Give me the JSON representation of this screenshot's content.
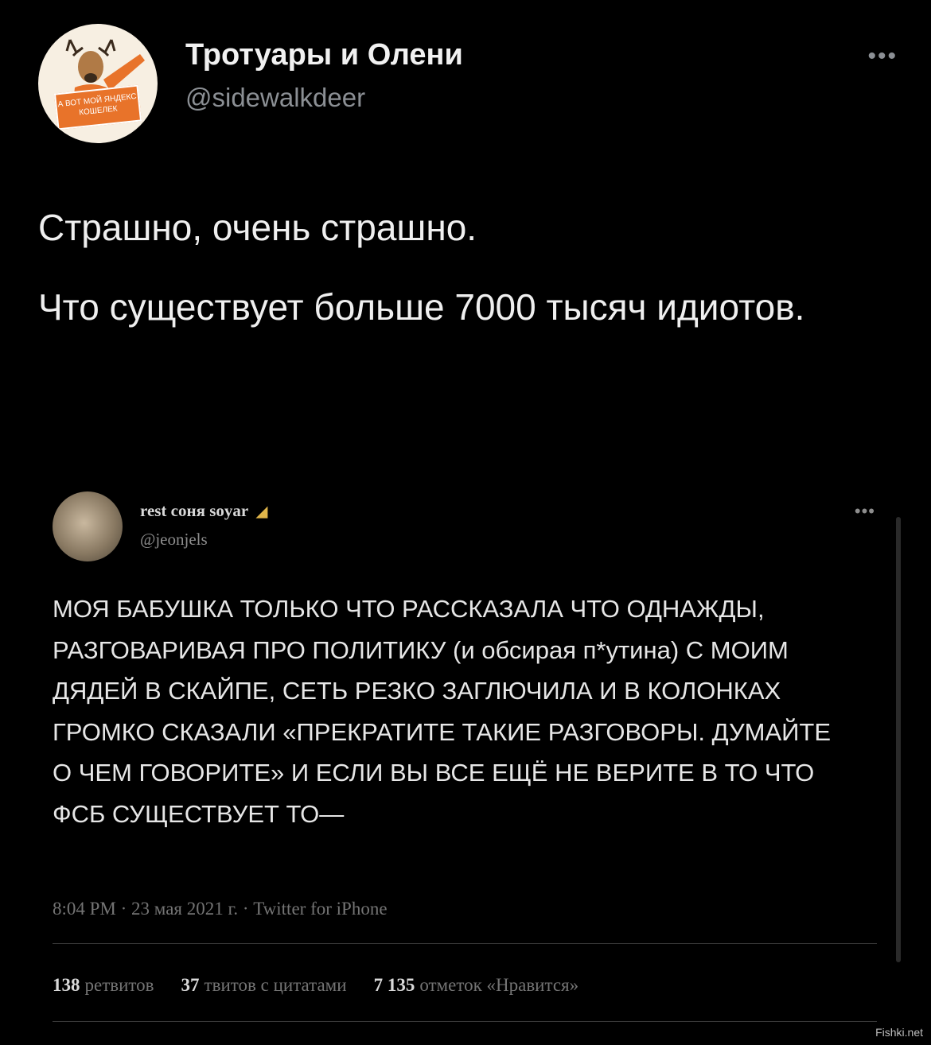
{
  "tweet": {
    "author_name": "Тротуары и Олени",
    "author_handle": "@sidewalkdeer",
    "more_icon": "more-dots-icon",
    "avatar_sign": "А ВОТ МОЙ ЯНДЕКС КОШЕЛЕК",
    "text_p1": "Страшно, очень страшно.",
    "text_p2": "Что существует больше 7000 тысяч идиотов."
  },
  "quoted": {
    "author_name": "rest соня soyar",
    "badge_icon": "cheese-emoji-icon",
    "author_handle": "@jeonjels",
    "text": "МОЯ БАБУШКА ТОЛЬКО ЧТО РАССКАЗАЛА ЧТО ОДНАЖДЫ, РАЗГОВАРИВАЯ ПРО ПОЛИТИКУ (и обсирая п*утина) С МОИМ ДЯДЕЙ В СКАЙПЕ, СЕТЬ РЕЗКО ЗАГЛЮЧИЛА И В КОЛОНКАХ ГРОМКО СКАЗАЛИ «ПРЕКРАТИТЕ ТАКИЕ РАЗГОВОРЫ. ДУМАЙТЕ О ЧЕМ ГОВОРИТЕ» И ЕСЛИ ВЫ ВСЕ ЕЩЁ НЕ ВЕРИТЕ В ТО ЧТО ФСБ СУЩЕСТВУЕТ ТО—",
    "meta": "8:04 PM · 23 мая 2021 г. · Twitter for iPhone",
    "stats": {
      "retweets_count": "138",
      "retweets_label": "ретвитов",
      "quotes_count": "37",
      "quotes_label": "твитов с цитатами",
      "likes_count": "7 135",
      "likes_label": "отметок «Нравится»"
    }
  },
  "watermark": "Fishki.net"
}
